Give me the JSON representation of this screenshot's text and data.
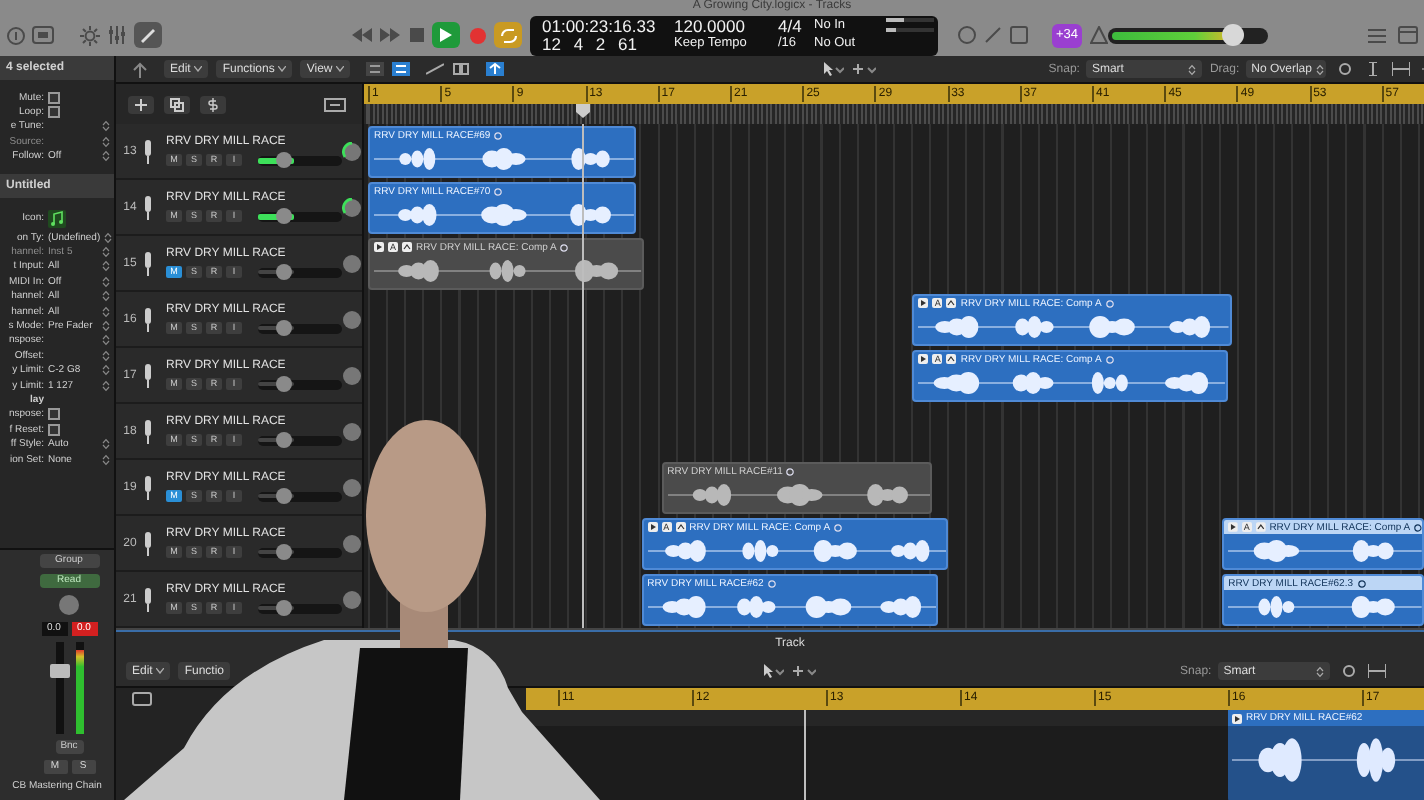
{
  "toolbar": {
    "title": "A Growing City.logicx - Tracks",
    "cycle": true,
    "lcd": {
      "time": "01:00:23:16.33",
      "tempo": "120.0000",
      "signature": "4/4",
      "midi_in": "No In",
      "position": "12 4 2 61",
      "tempo_mode": "Keep Tempo",
      "division": "/16",
      "midi_out": "No Out"
    },
    "badge": "+34",
    "master_volume": {
      "level": 0.78
    }
  },
  "inspector": {
    "title": "4 selected",
    "region_rows": [
      {
        "label": "Mute:",
        "kind": "checkbox",
        "checked": false
      },
      {
        "label": "Loop:",
        "kind": "checkbox",
        "checked": false
      },
      {
        "label": "e Tune:",
        "kind": "stepper",
        "disabled": false
      },
      {
        "label": "Source:",
        "kind": "stepper",
        "disabled": true
      },
      {
        "label": "Follow:",
        "value": "Off",
        "kind": "stepper",
        "disabled": false
      }
    ],
    "track_title": "Untitled",
    "track_rows": [
      {
        "label": "Icon:",
        "kind": "icon"
      },
      {
        "label": "on Ty:",
        "value": "(Undefined)",
        "kind": "stepper",
        "disabled": false
      },
      {
        "label": "hannel:",
        "value": "Inst 5",
        "kind": "stepper",
        "disabled": true
      },
      {
        "label": "t Input:",
        "value": "All",
        "kind": "stepper",
        "disabled": false
      },
      {
        "label": "MIDI In:",
        "value": "Off",
        "kind": "stepper",
        "disabled": false
      },
      {
        "label": "hannel:",
        "value": "All",
        "kind": "stepper",
        "disabled": false
      },
      {
        "label": "hannel:",
        "value": "All",
        "kind": "stepper",
        "disabled": false
      },
      {
        "label": "s Mode:",
        "value": "Pre Fader",
        "kind": "stepper",
        "disabled": false
      },
      {
        "label": "nspose:",
        "kind": "stepper",
        "disabled": false
      },
      {
        "label": "Offset:",
        "kind": "stepper",
        "disabled": false
      },
      {
        "label": "y Limit:",
        "value": "C-2 G8",
        "kind": "stepper",
        "disabled": false
      },
      {
        "label": "y Limit:",
        "value": "1 127",
        "kind": "stepper",
        "disabled": false
      },
      {
        "label": "lay",
        "kind": "heading"
      },
      {
        "label": "nspose:",
        "kind": "checkbox",
        "checked": false
      },
      {
        "label": "f Reset:",
        "kind": "checkbox",
        "checked": false
      },
      {
        "label": "ff Style:",
        "value": "Auto",
        "kind": "stepper",
        "disabled": false
      },
      {
        "label": "ion Set:",
        "value": "None",
        "kind": "stepper",
        "disabled": false
      }
    ],
    "channel": {
      "group": "Group",
      "automation": "Read",
      "readings": [
        {
          "text": "0.0",
          "clipped": false
        },
        {
          "text": "0.0",
          "clipped": true
        }
      ],
      "fader": {
        "level": 0.72
      },
      "meter": {
        "level": 0.92
      },
      "bounce": "Bnc",
      "buttons": [
        "M",
        "S"
      ],
      "name": "CB Mastering Chain"
    }
  },
  "tracks": {
    "menus": [
      "Edit",
      "Functions",
      "View"
    ],
    "snap": {
      "label": "Snap:",
      "value": "Smart"
    },
    "drag": {
      "label": "Drag:",
      "value": "No Overlap"
    },
    "ruler": [
      "1",
      "5",
      "9",
      "13",
      "17",
      "21",
      "25",
      "29",
      "33",
      "37",
      "41",
      "45",
      "49",
      "53",
      "57"
    ],
    "rows": [
      {
        "number": "13",
        "name": "RRV DRY MILL RACE",
        "buttons": [
          "M",
          "S",
          "R",
          "I"
        ],
        "selected": true,
        "muted": false,
        "level": 0.3,
        "regions": [
          {
            "name": "RRV DRY MILL RACE#69",
            "kind": "audio",
            "muted": false,
            "selected": false
          }
        ]
      },
      {
        "number": "14",
        "name": "RRV DRY MILL RACE",
        "buttons": [
          "M",
          "S",
          "R",
          "I"
        ],
        "selected": true,
        "muted": false,
        "level": 0.3,
        "regions": [
          {
            "name": "RRV DRY MILL RACE#70",
            "kind": "audio",
            "muted": false,
            "selected": false
          }
        ]
      },
      {
        "number": "15",
        "name": "RRV DRY MILL RACE",
        "buttons": [
          "M",
          "S",
          "R",
          "I"
        ],
        "selected": false,
        "muted": true,
        "level": 0.3,
        "regions": [
          {
            "name": "RRV DRY MILL RACE: Comp A",
            "kind": "comp",
            "take": "A",
            "muted": true,
            "selected": false
          }
        ]
      },
      {
        "number": "16",
        "name": "RRV DRY MILL RACE",
        "buttons": [
          "M",
          "S",
          "R",
          "I"
        ],
        "selected": false,
        "muted": false,
        "level": 0.3,
        "regions": [
          {
            "name": "RRV DRY MILL RACE: Comp A",
            "kind": "comp",
            "take": "A",
            "muted": false,
            "selected": false
          }
        ]
      },
      {
        "number": "17",
        "name": "RRV DRY MILL RACE",
        "buttons": [
          "M",
          "S",
          "R",
          "I"
        ],
        "selected": false,
        "muted": false,
        "level": 0.3,
        "regions": [
          {
            "name": "RRV DRY MILL RACE: Comp A",
            "kind": "comp",
            "take": "A",
            "muted": false,
            "selected": false
          }
        ]
      },
      {
        "number": "18",
        "name": "RRV DRY MILL RACE",
        "buttons": [
          "M",
          "S",
          "R",
          "I"
        ],
        "selected": false,
        "muted": false,
        "level": 0.3,
        "regions": []
      },
      {
        "number": "19",
        "name": "RRV DRY MILL RACE",
        "buttons": [
          "M",
          "S",
          "R",
          "I"
        ],
        "selected": false,
        "muted": true,
        "level": 0.3,
        "regions": [
          {
            "name": "RRV DRY MILL RACE#11",
            "kind": "audio",
            "muted": true,
            "selected": false
          }
        ]
      },
      {
        "number": "20",
        "name": "RRV DRY MILL RACE",
        "buttons": [
          "M",
          "S",
          "R",
          "I"
        ],
        "selected": false,
        "muted": false,
        "level": 0.3,
        "regions": [
          {
            "name": "RRV DRY MILL RACE: Comp A",
            "kind": "comp",
            "take": "A",
            "muted": false,
            "selected": false
          },
          {
            "name": "RRV DRY MILL RACE: Comp A",
            "kind": "comp",
            "take": "A",
            "muted": false,
            "selected": true
          }
        ]
      },
      {
        "number": "21",
        "name": "RRV DRY MILL RACE",
        "buttons": [
          "M",
          "S",
          "R",
          "I"
        ],
        "selected": false,
        "muted": false,
        "level": 0.3,
        "regions": [
          {
            "name": "RRV DRY MILL RACE#62",
            "kind": "audio",
            "muted": false,
            "selected": false
          },
          {
            "name": "RRV DRY MILL RACE#62.3",
            "kind": "audio",
            "muted": false,
            "selected": true
          }
        ]
      }
    ]
  },
  "editor": {
    "title": "Track",
    "menus": [
      "Edit",
      "Functio"
    ],
    "snap": {
      "label": "Snap:",
      "value": "Smart"
    },
    "ruler": [
      "11",
      "12",
      "13",
      "14",
      "15",
      "16",
      "17"
    ],
    "regions": [
      {
        "name": "RRV DRY MILL RACE#62"
      }
    ]
  }
}
